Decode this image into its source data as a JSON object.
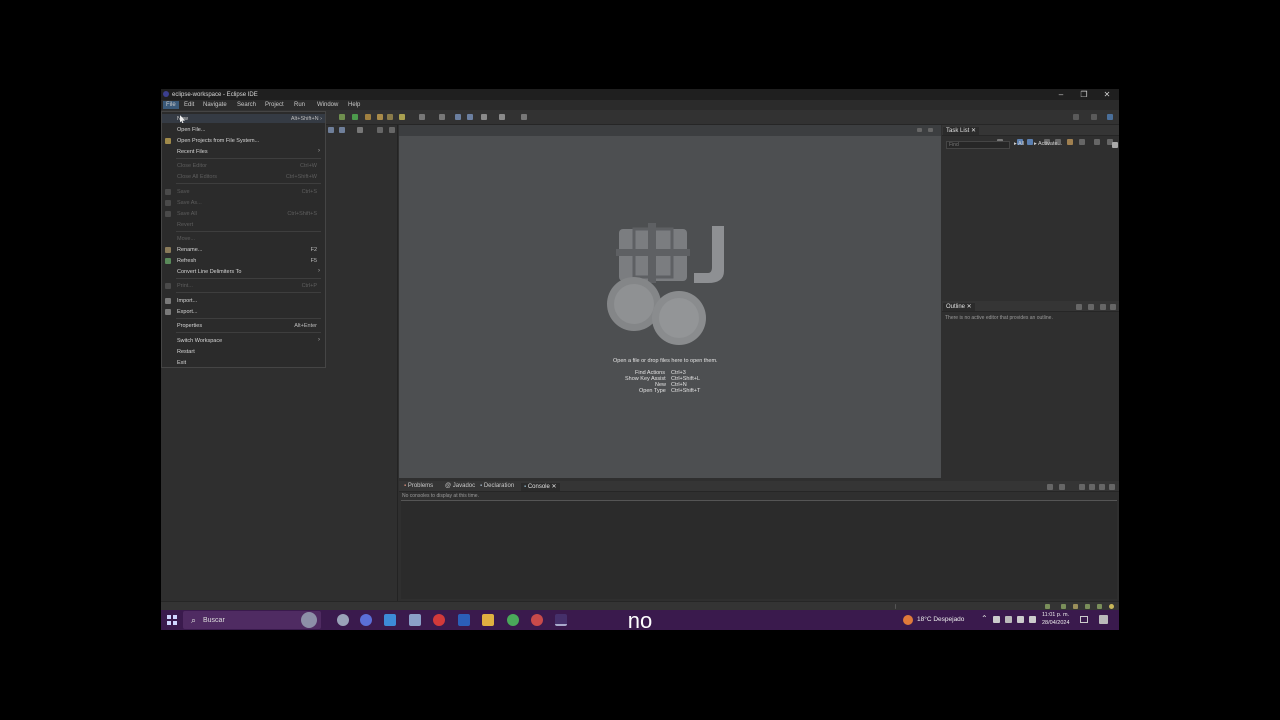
{
  "window": {
    "title": "eclipse-workspace - Eclipse IDE",
    "controls": {
      "minimize": "–",
      "maximize": "❐",
      "close": "✕"
    }
  },
  "menubar": [
    "File",
    "Edit",
    "Navigate",
    "Search",
    "Project",
    "Run",
    "Window",
    "Help"
  ],
  "file_menu": {
    "items": [
      {
        "label": "New",
        "shortcut": "Alt+Shift+N ›",
        "disabled": false
      },
      {
        "label": "Open File...",
        "shortcut": "",
        "disabled": false
      },
      {
        "label": "Open Projects from File System...",
        "shortcut": "",
        "disabled": false
      },
      {
        "label": "Recent Files",
        "shortcut": "",
        "disabled": false,
        "submenu": true
      },
      {
        "label": "Close Editor",
        "shortcut": "Ctrl+W",
        "disabled": true
      },
      {
        "label": "Close All Editors",
        "shortcut": "Ctrl+Shift+W",
        "disabled": true
      },
      {
        "label": "Save",
        "shortcut": "Ctrl+S",
        "disabled": true
      },
      {
        "label": "Save As...",
        "shortcut": "",
        "disabled": true
      },
      {
        "label": "Save All",
        "shortcut": "Ctrl+Shift+S",
        "disabled": true
      },
      {
        "label": "Revert",
        "shortcut": "",
        "disabled": true
      },
      {
        "label": "Move...",
        "shortcut": "",
        "disabled": true
      },
      {
        "label": "Rename...",
        "shortcut": "F2",
        "disabled": false
      },
      {
        "label": "Refresh",
        "shortcut": "F5",
        "disabled": false
      },
      {
        "label": "Convert Line Delimiters To",
        "shortcut": "",
        "disabled": false,
        "submenu": true
      },
      {
        "label": "Print...",
        "shortcut": "Ctrl+P",
        "disabled": true
      },
      {
        "label": "Import...",
        "shortcut": "",
        "disabled": false
      },
      {
        "label": "Export...",
        "shortcut": "",
        "disabled": false
      },
      {
        "label": "Properties",
        "shortcut": "Alt+Enter",
        "disabled": false
      },
      {
        "label": "Switch Workspace",
        "shortcut": "",
        "disabled": false,
        "submenu": true
      },
      {
        "label": "Restart",
        "shortcut": "",
        "disabled": false
      },
      {
        "label": "Exit",
        "shortcut": "",
        "disabled": false
      }
    ],
    "submenu_arrow": "›"
  },
  "editor": {
    "open_hint": "Open a file or drop files here to open them.",
    "shortcuts": [
      {
        "label": "Find Actions",
        "keys": "Ctrl+3"
      },
      {
        "label": "Show Key Assist",
        "keys": "Ctrl+Shift+L"
      },
      {
        "label": "New",
        "keys": "Ctrl+N"
      },
      {
        "label": "Open Type",
        "keys": "Ctrl+Shift+T"
      }
    ]
  },
  "task_list": {
    "tab": "Task List",
    "filter_placeholder": "Find",
    "all_label": "All",
    "activate_label": "Activate..."
  },
  "outline": {
    "tab": "Outline",
    "message": "There is no active editor that provides an outline."
  },
  "bottom_panel": {
    "tabs": [
      "Problems",
      "Javadoc",
      "Declaration",
      "Console"
    ],
    "active_tab": "Console",
    "message": "No consoles to display at this time."
  },
  "taskbar": {
    "search_label": "Buscar",
    "weather": "18°C  Despejado",
    "time": "11:01 p. m.",
    "date": "28/04/2024"
  },
  "caption": "no",
  "colors": {
    "taskbar": "#3a1a4d",
    "editor_bg": "#4d4f51",
    "menu_bg": "#2b2b2b"
  }
}
